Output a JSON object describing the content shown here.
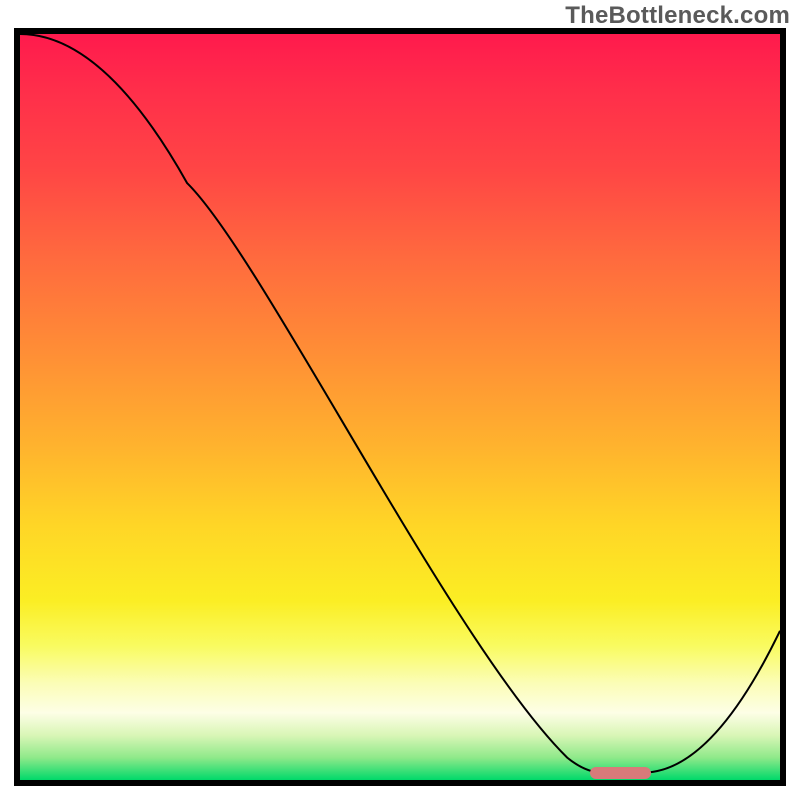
{
  "watermark": "TheBottleneck.com",
  "chart_data": {
    "type": "line",
    "title": "",
    "xlabel": "",
    "ylabel": "",
    "xlim": [
      0,
      100
    ],
    "ylim": [
      0,
      100
    ],
    "grid": false,
    "legend": false,
    "series": [
      {
        "name": "bottleneck-curve",
        "color": "#000000",
        "x": [
          0,
          22,
          72,
          78,
          82,
          100
        ],
        "values": [
          100,
          80,
          3,
          1,
          1,
          20
        ]
      }
    ],
    "marker": {
      "name": "optimal-range",
      "color": "#d87a7a",
      "x_start": 75,
      "x_end": 83,
      "y": 1,
      "shape": "rounded-bar"
    },
    "background_gradient": {
      "direction": "vertical",
      "stops": [
        {
          "pos": 0,
          "color": "#ff1a4d"
        },
        {
          "pos": 18,
          "color": "#ff4545"
        },
        {
          "pos": 42,
          "color": "#ff8c36"
        },
        {
          "pos": 66,
          "color": "#ffd626"
        },
        {
          "pos": 82,
          "color": "#f9fb60"
        },
        {
          "pos": 91,
          "color": "#fdfee6"
        },
        {
          "pos": 100,
          "color": "#00d96a"
        }
      ]
    }
  }
}
